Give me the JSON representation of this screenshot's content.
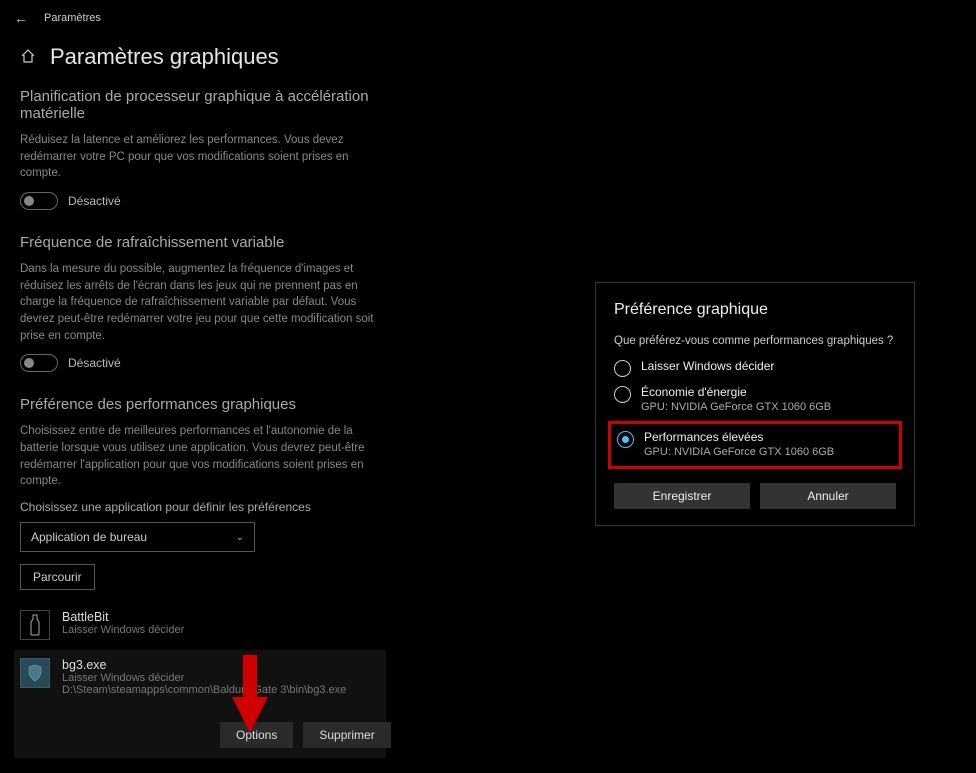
{
  "titlebar": {
    "title": "Paramètres"
  },
  "page": {
    "title": "Paramètres graphiques"
  },
  "sections": {
    "hwSched": {
      "title": "Planification de processeur graphique à accélération matérielle",
      "desc": "Réduisez la latence et améliorez les performances. Vous devez redémarrer votre PC pour que vos modifications soient prises en compte.",
      "toggle_label": "Désactivé"
    },
    "vrr": {
      "title": "Fréquence de rafraîchissement variable",
      "desc": "Dans la mesure du possible, augmentez la fréquence d'images et réduisez les arrêts de l'écran dans les jeux qui ne prennent pas en charge la fréquence de rafraîchissement variable par défaut. Vous devrez peut-être redémarrer votre jeu pour que cette modification soit prise en compte.",
      "toggle_label": "Désactivé"
    },
    "perf": {
      "title": "Préférence des performances graphiques",
      "desc": "Choisissez entre de meilleures performances et l'autonomie de la batterie lorsque vous utilisez une application. Vous devrez peut-être redémarrer l'application pour que vos modifications soient prises en compte.",
      "choose_label": "Choisissez une application pour définir les préférences",
      "dropdown_value": "Application de bureau",
      "browse_label": "Parcourir"
    }
  },
  "apps": [
    {
      "name": "BattleBit",
      "pref": "Laisser Windows décider"
    },
    {
      "name": "bg3.exe",
      "pref": "Laisser Windows décider",
      "path": "D:\\Steam\\steamapps\\common\\Baldurs Gate 3\\bin\\bg3.exe"
    }
  ],
  "buttons": {
    "options": "Options",
    "delete": "Supprimer"
  },
  "dialog": {
    "title": "Préférence graphique",
    "question": "Que préférez-vous comme performances graphiques ?",
    "options": [
      {
        "label": "Laisser Windows décider",
        "sub": ""
      },
      {
        "label": "Économie d'énergie",
        "sub": "GPU: NVIDIA GeForce GTX 1060 6GB"
      },
      {
        "label": "Performances élevées",
        "sub": "GPU: NVIDIA GeForce GTX 1060 6GB"
      }
    ],
    "save": "Enregistrer",
    "cancel": "Annuler"
  }
}
